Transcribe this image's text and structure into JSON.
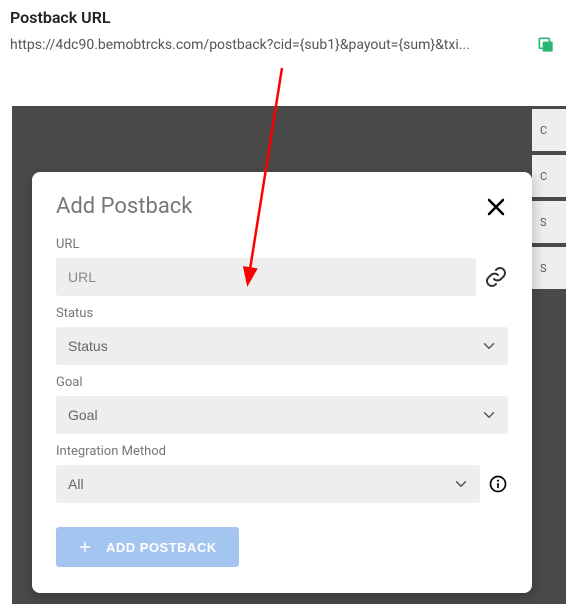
{
  "top": {
    "heading": "Postback URL",
    "url": "https://4dc90.bemobtrcks.com/postback?cid={sub1}&payout={sum}&txi..."
  },
  "side": {
    "items": [
      "C",
      "C",
      "S",
      "S"
    ]
  },
  "modal": {
    "title": "Add Postback",
    "url_label": "URL",
    "url_placeholder": "URL",
    "url_value": "",
    "status_label": "Status",
    "status_selected": "Status",
    "goal_label": "Goal",
    "goal_selected": "Goal",
    "integration_label": "Integration Method",
    "integration_selected": "All",
    "add_button": "ADD POSTBACK"
  }
}
